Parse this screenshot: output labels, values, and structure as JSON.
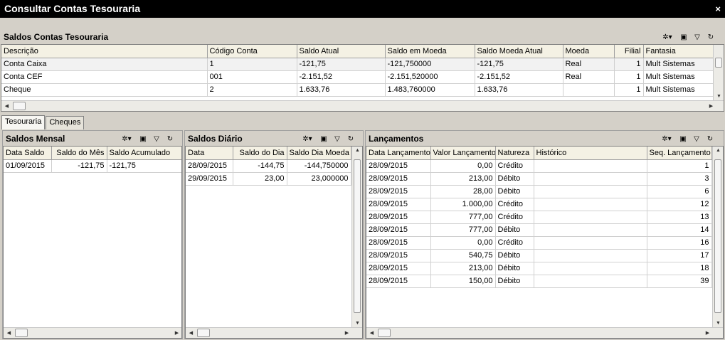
{
  "window": {
    "title": "Consultar Contas Tesouraria",
    "close_glyph": "×"
  },
  "top_section": {
    "title": "Saldos Contas Tesouraria",
    "columns": [
      "Descrição",
      "Código Conta",
      "Saldo Atual",
      "Saldo em Moeda",
      "Saldo Moeda Atual",
      "Moeda",
      "Filial",
      "Fantasia"
    ],
    "rows": [
      [
        "Conta Caixa",
        "1",
        "-121,75",
        "-121,750000",
        "-121,75",
        "Real",
        "1",
        "Mult Sistemas"
      ],
      [
        "Conta CEF",
        "001",
        "-2.151,52",
        "-2.151,520000",
        "-2.151,52",
        "Real",
        "1",
        "Mult Sistemas"
      ],
      [
        "Cheque",
        "2",
        "1.633,76",
        "1.483,760000",
        "1.633,76",
        "",
        "1",
        "Mult Sistemas"
      ]
    ]
  },
  "tabs": [
    {
      "label": "Tesouraria"
    },
    {
      "label": "Cheques"
    }
  ],
  "saldos_mensal": {
    "title": "Saldos Mensal",
    "columns": [
      "Data Saldo",
      "Saldo do Mês",
      "Saldo Acumulado"
    ],
    "rows": [
      [
        "01/09/2015",
        "-121,75",
        "-121,75"
      ]
    ]
  },
  "saldos_diario": {
    "title": "Saldos Diário",
    "columns": [
      "Data",
      "Saldo do Dia",
      "Saldo Dia Moeda"
    ],
    "rows": [
      [
        "28/09/2015",
        "-144,75",
        "-144,750000"
      ],
      [
        "29/09/2015",
        "23,00",
        "23,000000"
      ]
    ]
  },
  "lancamentos": {
    "title": "Lançamentos",
    "columns": [
      "Data Lançamento",
      "Valor Lançamento",
      "Natureza",
      "Histórico",
      "Seq. Lançamento"
    ],
    "rows": [
      [
        "28/09/2015",
        "0,00",
        "Crédito",
        "",
        "1"
      ],
      [
        "28/09/2015",
        "213,00",
        "Débito",
        "",
        "3"
      ],
      [
        "28/09/2015",
        "28,00",
        "Débito",
        "",
        "6"
      ],
      [
        "28/09/2015",
        "1.000,00",
        "Crédito",
        "",
        "12"
      ],
      [
        "28/09/2015",
        "777,00",
        "Crédito",
        "",
        "13"
      ],
      [
        "28/09/2015",
        "777,00",
        "Débito",
        "",
        "14"
      ],
      [
        "28/09/2015",
        "0,00",
        "Crédito",
        "",
        "16"
      ],
      [
        "28/09/2015",
        "540,75",
        "Débito",
        "",
        "17"
      ],
      [
        "28/09/2015",
        "213,00",
        "Débito",
        "",
        "18"
      ],
      [
        "28/09/2015",
        "150,00",
        "Débito",
        "",
        "39"
      ]
    ]
  },
  "toolbar_icons": [
    "columns-chooser-icon",
    "export-icon",
    "filter-icon",
    "refresh-icon"
  ]
}
